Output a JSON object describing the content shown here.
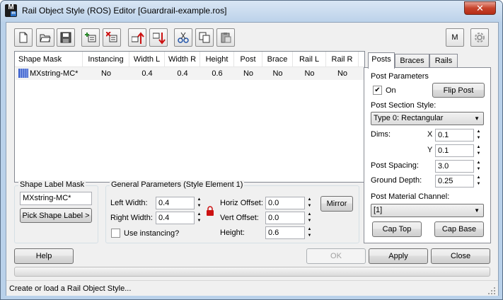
{
  "window": {
    "title": "Rail Object Style (ROS) Editor [Guardrail-example.ros]",
    "app_icon_letter": "M",
    "app_icon_sub": "m",
    "close_glyph": "✕"
  },
  "toolbar": {
    "buttons": [
      "new",
      "open",
      "save",
      "add-row",
      "delete-row",
      "move-up",
      "move-down",
      "cut",
      "copy",
      "paste"
    ],
    "m_button_label": "M",
    "colors": {
      "arrow_red": "#cc1111"
    }
  },
  "list": {
    "columns": [
      "Shape Mask",
      "Instancing",
      "Width L",
      "Width R",
      "Height",
      "Post",
      "Brace",
      "Rail L",
      "Rail R"
    ],
    "rows": [
      [
        "MXstring-MC*",
        "No",
        "0.4",
        "0.4",
        "0.6",
        "No",
        "No",
        "No",
        "No"
      ]
    ]
  },
  "shape_label_mask": {
    "title": "Shape Label Mask",
    "value": "MXstring-MC*",
    "pick_button": "Pick Shape Label  >"
  },
  "general": {
    "title": "General Parameters (Style Element 1)",
    "left_width_label": "Left Width:",
    "left_width": "0.4",
    "right_width_label": "Right Width:",
    "right_width": "0.4",
    "use_instancing_label": "Use instancing?",
    "use_instancing": false,
    "horiz_offset_label": "Horiz Offset:",
    "horiz_offset": "0.0",
    "vert_offset_label": "Vert Offset:",
    "vert_offset": "0.0",
    "height_label": "Height:",
    "height": "0.6",
    "mirror_button": "Mirror"
  },
  "tabs": {
    "items": [
      "Posts",
      "Braces",
      "Rails"
    ],
    "active": "Posts"
  },
  "posts": {
    "section_title": "Post Parameters",
    "on_label": "On",
    "on_checked": true,
    "check_glyph": "✔",
    "flip_button": "Flip Post",
    "section_style_label": "Post Section Style:",
    "section_style_value": "Type 0: Rectangular",
    "dims_label": "Dims:",
    "x_label": "X",
    "x_value": "0.1",
    "y_label": "Y",
    "y_value": "0.1",
    "spacing_label": "Post Spacing:",
    "spacing_value": "3.0",
    "ground_depth_label": "Ground Depth:",
    "ground_depth_value": "0.25",
    "material_label": "Post Material Channel:",
    "material_value": "[1]",
    "cap_top_button": "Cap Top",
    "cap_base_button": "Cap Base"
  },
  "bottom": {
    "help": "Help",
    "ok": "OK",
    "apply": "Apply",
    "close": "Close"
  },
  "status": {
    "text": "Create or load a Rail Object Style..."
  }
}
